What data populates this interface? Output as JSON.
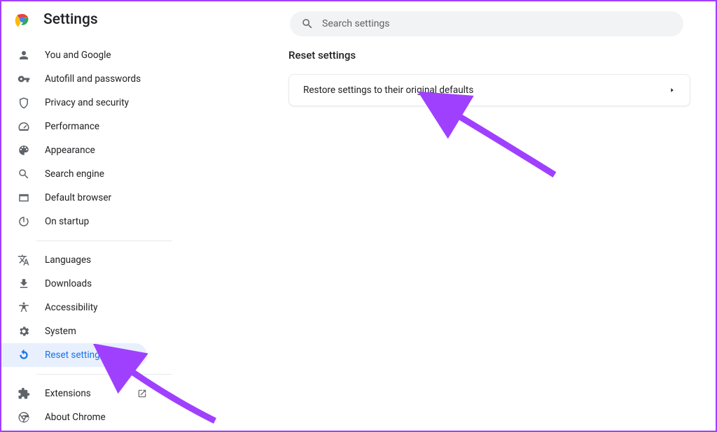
{
  "header": {
    "title": "Settings",
    "search_placeholder": "Search settings"
  },
  "sidebar": {
    "group1": [
      {
        "id": "you-and-google",
        "label": "You and Google"
      },
      {
        "id": "autofill",
        "label": "Autofill and passwords"
      },
      {
        "id": "privacy",
        "label": "Privacy and security"
      },
      {
        "id": "performance",
        "label": "Performance"
      },
      {
        "id": "appearance",
        "label": "Appearance"
      },
      {
        "id": "search-engine",
        "label": "Search engine"
      },
      {
        "id": "default-browser",
        "label": "Default browser"
      },
      {
        "id": "on-startup",
        "label": "On startup"
      }
    ],
    "group2": [
      {
        "id": "languages",
        "label": "Languages"
      },
      {
        "id": "downloads",
        "label": "Downloads"
      },
      {
        "id": "accessibility",
        "label": "Accessibility"
      },
      {
        "id": "system",
        "label": "System"
      },
      {
        "id": "reset-settings",
        "label": "Reset settings",
        "active": true
      }
    ],
    "group3": [
      {
        "id": "extensions",
        "label": "Extensions",
        "external": true
      },
      {
        "id": "about-chrome",
        "label": "About Chrome"
      }
    ]
  },
  "main": {
    "section_title": "Reset settings",
    "card_row_label": "Restore settings to their original defaults"
  },
  "colors": {
    "accent": "#1a73e8",
    "active_bg": "#e8f0fe",
    "annotation": "#a040ff"
  }
}
